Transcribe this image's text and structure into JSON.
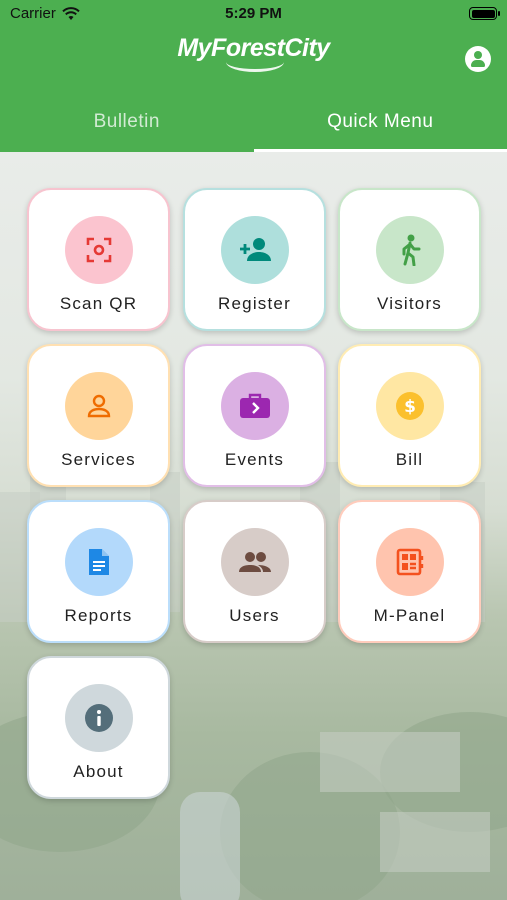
{
  "status_bar": {
    "carrier": "Carrier",
    "time": "5:29 PM"
  },
  "header": {
    "logo_text": "MyForestCity"
  },
  "tabs": [
    {
      "label": "Bulletin",
      "active": false
    },
    {
      "label": "Quick Menu",
      "active": true
    }
  ],
  "menu": [
    {
      "label": "Scan QR",
      "icon": "qr-scan-icon",
      "border": "#f7c4cf",
      "circle": "#fbc4cf",
      "color": "#e53935"
    },
    {
      "label": "Register",
      "icon": "add-person-icon",
      "border": "#b6e0df",
      "circle": "#aedfdc",
      "color": "#00897b"
    },
    {
      "label": "Visitors",
      "icon": "walking-person-icon",
      "border": "#c8e6c9",
      "circle": "#c8e6c9",
      "color": "#43a047"
    },
    {
      "label": "Services",
      "icon": "person-outline-icon",
      "border": "#ffe0b2",
      "circle": "#ffd59a",
      "color": "#ef6c00"
    },
    {
      "label": "Events",
      "icon": "briefcase-icon",
      "border": "#e1bee7",
      "circle": "#dbb0e3",
      "color": "#9c27b0"
    },
    {
      "label": "Bill",
      "icon": "dollar-icon",
      "border": "#ffecb3",
      "circle": "#ffe7a3",
      "color": "#fbc02d"
    },
    {
      "label": "Reports",
      "icon": "document-icon",
      "border": "#bbdefb",
      "circle": "#b3d9fb",
      "color": "#1e88e5"
    },
    {
      "label": "Users",
      "icon": "people-icon",
      "border": "#d7ccc8",
      "circle": "#d7ccc8",
      "color": "#6d4c41"
    },
    {
      "label": "M-Panel",
      "icon": "panel-icon",
      "border": "#ffccbc",
      "circle": "#ffc4ae",
      "color": "#f4511e"
    },
    {
      "label": "About",
      "icon": "info-icon",
      "border": "#cfd8dc",
      "circle": "#cfd8dc",
      "color": "#546e7a"
    }
  ]
}
